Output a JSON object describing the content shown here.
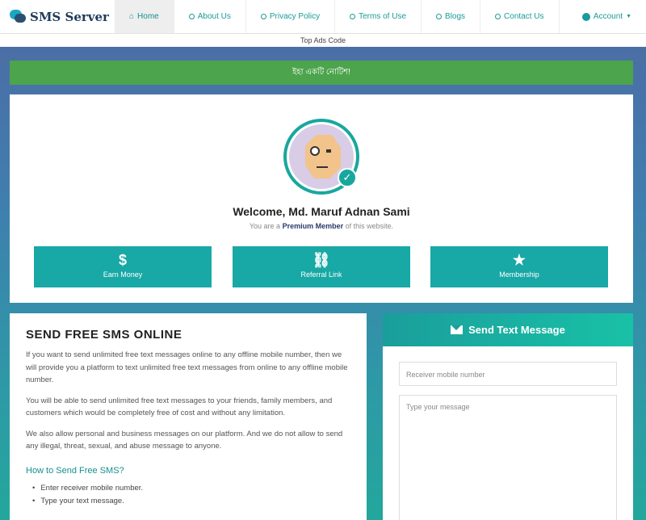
{
  "brand": {
    "name": "SMS Server"
  },
  "nav": {
    "items": [
      {
        "label": "Home",
        "active": true
      },
      {
        "label": "About Us"
      },
      {
        "label": "Privacy Policy"
      },
      {
        "label": "Terms of Use"
      },
      {
        "label": "Blogs"
      },
      {
        "label": "Contact Us"
      }
    ],
    "account_label": "Account"
  },
  "ads": {
    "top": "Top Ads Code"
  },
  "notice": {
    "text": "ইহা একটি নোটিশ!"
  },
  "profile": {
    "welcome": "Welcome, Md. Maruf Adnan Sami",
    "member_prefix": "You are a",
    "member_type": "Premium Member",
    "member_suffix": "of this website."
  },
  "actions": [
    {
      "label": "Earn Money",
      "icon": "dollar-icon"
    },
    {
      "label": "Referral Link",
      "icon": "link-icon"
    },
    {
      "label": "Membership",
      "icon": "star-icon"
    }
  ],
  "info": {
    "title": "SEND FREE SMS ONLINE",
    "paragraphs": [
      "If you want to send unlimited free text messages online to any offline mobile number, then we will provide you a platform to text unlimited free text messages from online to any offline mobile number.",
      "You will be able to send unlimited free text messages to your friends, family members, and customers which would be completely free of cost and without any limitation.",
      "We also allow personal and business messages on our platform. And we do not allow to send any illegal, threat, sexual, and abuse message to anyone."
    ],
    "subheading": "How to Send Free SMS?",
    "steps": [
      "Enter receiver mobile number.",
      "Type your text message."
    ]
  },
  "sms_form": {
    "title": "Send Text Message",
    "mobile_placeholder": "Receiver mobile number",
    "message_placeholder": "Type your message"
  },
  "colors": {
    "accent": "#18a8a6",
    "notice": "#4ca44c"
  }
}
